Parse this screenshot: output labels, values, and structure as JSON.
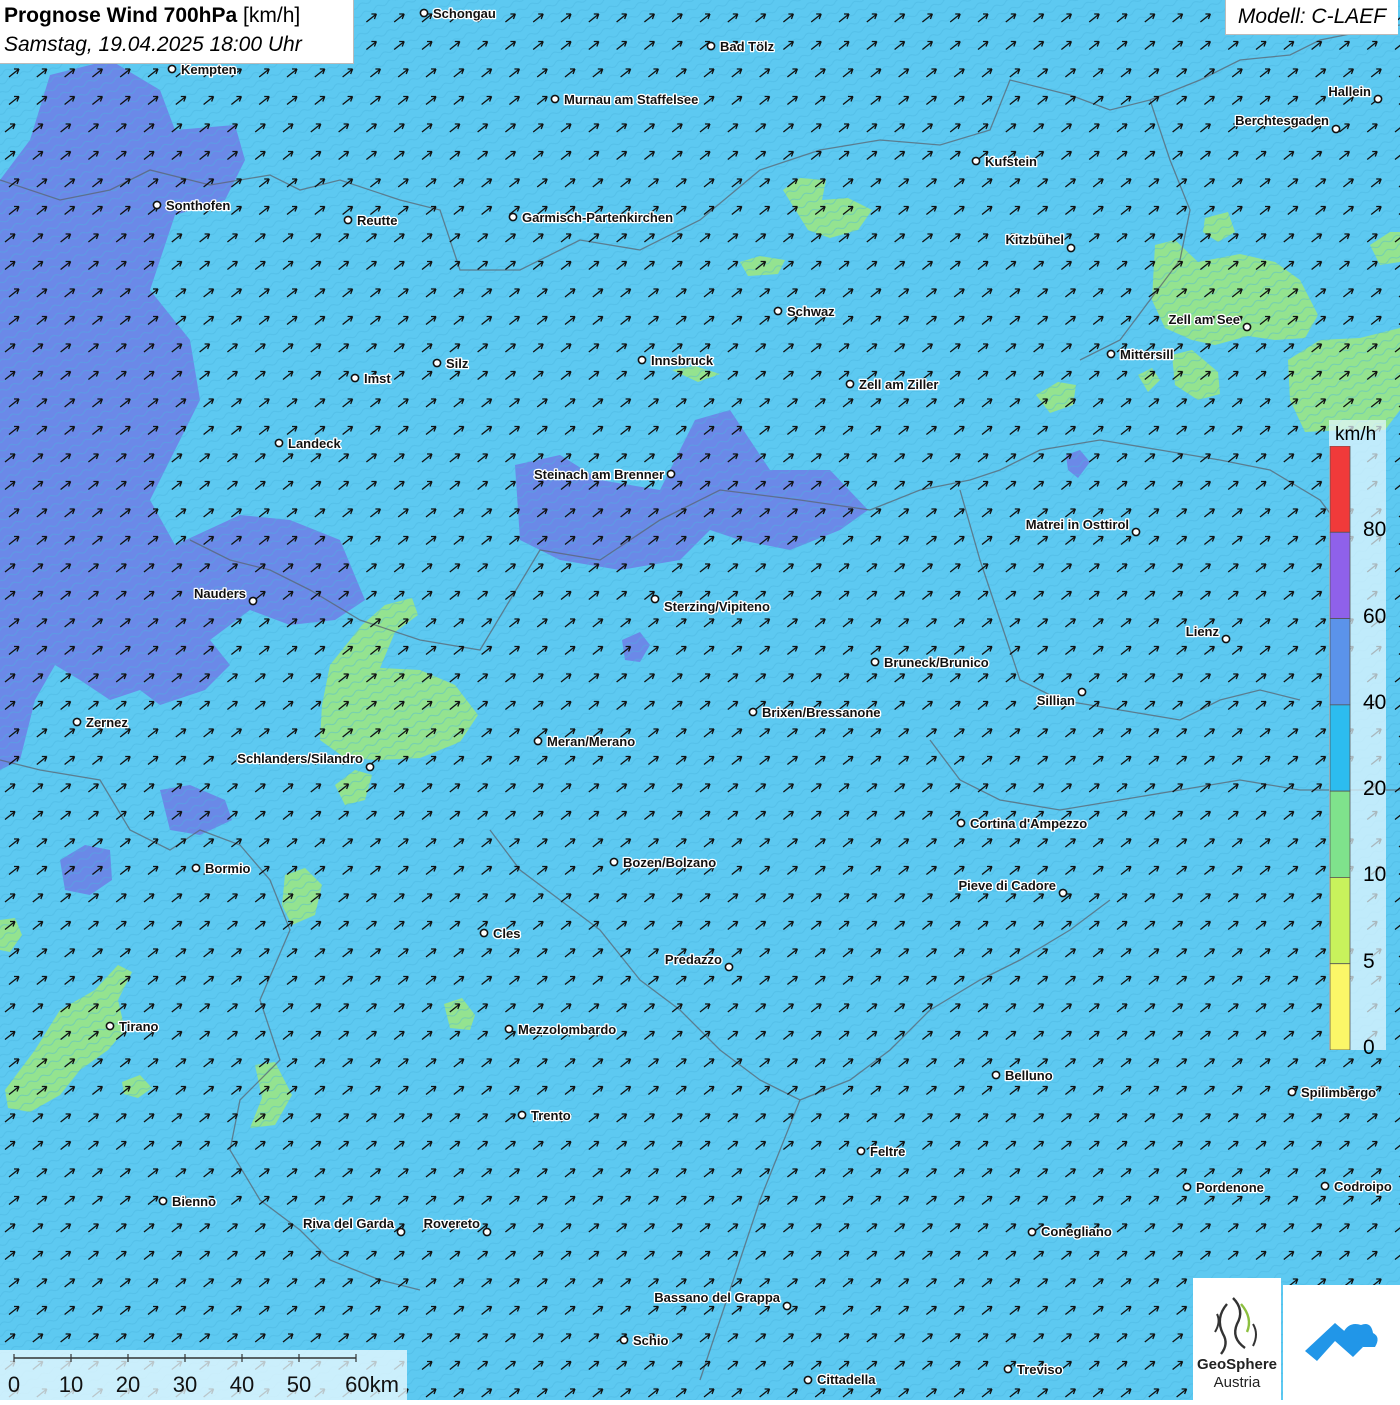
{
  "header": {
    "title_bold": "Prognose Wind 700hPa",
    "title_unit": "[km/h]",
    "datetime": "Samstag, 19.04.2025 18:00 Uhr",
    "model": "Modell: C-LAEF"
  },
  "legend": {
    "unit": "km/h",
    "ticks": [
      "80",
      "60",
      "40",
      "20",
      "10",
      "5",
      "0"
    ],
    "colors": [
      "#f03a3a",
      "#8f61ea",
      "#5b93ea",
      "#2cbcef",
      "#7fe28c",
      "#c8f25c",
      "#fbf768"
    ]
  },
  "colors": {
    "base_fill": "#5dc9f1",
    "purple_fill": "#6d7ee6",
    "green_fill": "#97e58a",
    "border": "#5a6470"
  },
  "scalebar": {
    "labels": [
      "0",
      "10",
      "20",
      "30",
      "40",
      "50",
      "60km"
    ]
  },
  "logos": {
    "geosphere_line1": "GeoSphere",
    "geosphere_line2": "Austria"
  },
  "cities": [
    {
      "name": "Schongau"
    },
    {
      "name": "Bad Tölz"
    },
    {
      "name": "Kempten"
    },
    {
      "name": "Murnau am Staffelsee"
    },
    {
      "name": "Hallein"
    },
    {
      "name": "Berchtesgaden"
    },
    {
      "name": "Kufstein"
    },
    {
      "name": "Sonthofen"
    },
    {
      "name": "Reutte"
    },
    {
      "name": "Garmisch-Partenkirchen"
    },
    {
      "name": "Kitzbühel"
    },
    {
      "name": "Schwaz"
    },
    {
      "name": "Zell am See"
    },
    {
      "name": "Mittersill"
    },
    {
      "name": "Innsbruck"
    },
    {
      "name": "Silz"
    },
    {
      "name": "Imst"
    },
    {
      "name": "Zell am Ziller"
    },
    {
      "name": "Landeck"
    },
    {
      "name": "Steinach am Brenner"
    },
    {
      "name": "Matrei in Osttirol"
    },
    {
      "name": "Nauders"
    },
    {
      "name": "Sterzing/Vipiteno"
    },
    {
      "name": "Lienz"
    },
    {
      "name": "Bruneck/Brunico"
    },
    {
      "name": "Sillian"
    },
    {
      "name": "Brixen/Bressanone"
    },
    {
      "name": "Zernez"
    },
    {
      "name": "Meran/Merano"
    },
    {
      "name": "Schlanders/Silandro"
    },
    {
      "name": "Cortina d'Ampezzo"
    },
    {
      "name": "Bozen/Bolzano"
    },
    {
      "name": "Bormio"
    },
    {
      "name": "Pieve di Cadore"
    },
    {
      "name": "Cles"
    },
    {
      "name": "Predazzo"
    },
    {
      "name": "Tirano"
    },
    {
      "name": "Mezzolombardo"
    },
    {
      "name": "Belluno"
    },
    {
      "name": "Spilimbergo"
    },
    {
      "name": "Trento"
    },
    {
      "name": "Feltre"
    },
    {
      "name": "Pordenone"
    },
    {
      "name": "Codroipo"
    },
    {
      "name": "Bienno"
    },
    {
      "name": "Riva del Garda"
    },
    {
      "name": "Rovereto"
    },
    {
      "name": "Conegliano"
    },
    {
      "name": "Bassano del Grappa"
    },
    {
      "name": "Schio"
    },
    {
      "name": "Treviso"
    },
    {
      "name": "Cittadella"
    }
  ]
}
